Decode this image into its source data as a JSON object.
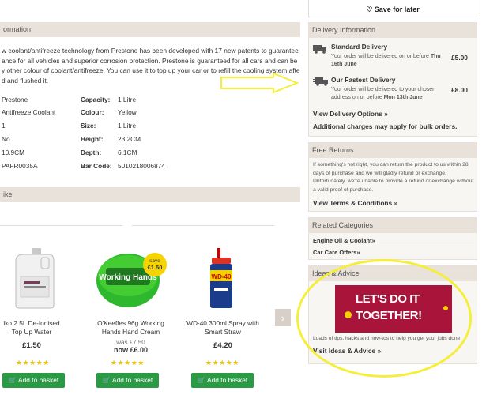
{
  "save_later": {
    "label": "Save for later"
  },
  "info": {
    "title": "ormation",
    "lines": [
      "w coolant/antifreeze technology from Prestone has been developed with 17 new patents to guarantee",
      "ance for all vehicles and superior corrosion protection. Prestone is guaranteed for all cars and can be",
      "y other colour of coolant/antifreeze. You can use it to top up your car or to refill the cooling system after",
      "d and flushed it."
    ],
    "specs": [
      {
        "v1": "Prestone",
        "l2": "Capacity:",
        "v2": "1 Litre"
      },
      {
        "v1": "Antifreeze Coolant",
        "l2": "Colour:",
        "v2": "Yellow"
      },
      {
        "v1": "1",
        "l2": "Size:",
        "v2": "1 Litre"
      },
      {
        "v1": "No",
        "l2": "Height:",
        "v2": "23.2CM"
      },
      {
        "v1": "10.9CM",
        "l2": "Depth:",
        "v2": "6.1CM"
      },
      {
        "v1": "PAFR0035A",
        "l2": "Bar Code:",
        "v2": "5010218006874"
      }
    ]
  },
  "like": {
    "title": "ike"
  },
  "products": [
    {
      "name": "lko 2.5L De-Ionised Top Up Water",
      "price": "£1.50",
      "was": "",
      "now": "",
      "stars": "★★★★★",
      "button": "Add to basket"
    },
    {
      "name": "O'Keeffes 96g Working Hands Hand Cream",
      "price": "",
      "was": "was £7.50",
      "now": "now £6.00",
      "stars": "★★★★★",
      "button": "Add to basket",
      "badge_top": "save",
      "badge_amount": "£1.50",
      "label_text": "Working Hands"
    },
    {
      "name": "WD-40 300ml Spray with Smart Straw",
      "price": "£4.20",
      "was": "",
      "now": "",
      "stars": "★★★★★",
      "button": "Add to basket",
      "can_label": "WD-40"
    }
  ],
  "delivery": {
    "title": "Delivery Information",
    "standard": {
      "title": "Standard Delivery",
      "text1": "Your order will be delivered on or before",
      "date1": "Thu",
      "date2": "16th June",
      "price": "£5.00"
    },
    "fastest": {
      "title": "Our Fastest Delivery",
      "text1": "Your order will be delivered to your chosen",
      "text2": "address on or before",
      "date": "Mon 13th June",
      "price": "£8.00"
    },
    "options_link": "View Delivery Options »",
    "bulk_note": "Additional charges may apply for bulk orders."
  },
  "returns": {
    "title": "Free Returns",
    "lines": [
      "If something's not right, you can return the product to us within 28",
      "days of purchase and we will gladly refund or exchange.",
      "Unfortunately, we're unable to provide a refund or exchange without",
      "a valid proof of purchase."
    ],
    "link": "View Terms & Conditions »"
  },
  "related": {
    "title": "Related Categories",
    "items": [
      "Engine Oil & Coolant»",
      "Car Care Offers»"
    ]
  },
  "ideas": {
    "title": "Ideas & Advice",
    "banner_line1": "LET'S DO IT",
    "banner_line2": "TOGETHER!",
    "text": "Loads of tips, hacks and how-tos to help you get your jobs done",
    "link": "Visit Ideas & Advice »"
  }
}
